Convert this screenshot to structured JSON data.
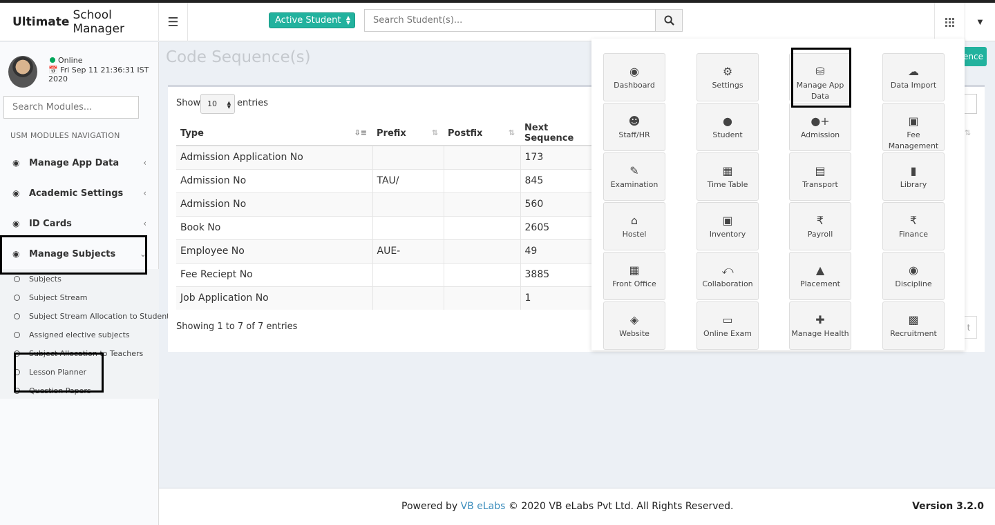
{
  "header": {
    "brand_bold": "Ultimate",
    "brand_rest": "School Manager",
    "student_filter": "Active Student",
    "search_placeholder": "Search Student(s)..."
  },
  "sidebar": {
    "status": "Online",
    "datetime": "Fri Sep 11 21:36:31 IST 2020",
    "module_search_placeholder": "Search Modules...",
    "nav_header": "USM MODULES NAVIGATION",
    "items": [
      {
        "label": "Manage App Data"
      },
      {
        "label": "Academic Settings"
      },
      {
        "label": "ID Cards"
      },
      {
        "label": "Manage Subjects"
      }
    ],
    "sub_items": [
      {
        "label": "Subjects"
      },
      {
        "label": "Subject Stream"
      },
      {
        "label": "Subject Stream Allocation to Students"
      },
      {
        "label": "Assigned elective subjects"
      },
      {
        "label": "Subject Allocation to Teachers"
      },
      {
        "label": "Lesson Planner"
      },
      {
        "label": "Question Papers"
      }
    ]
  },
  "main": {
    "title": "Code Sequence(s)",
    "add_button_partial": "ence",
    "show": "Show",
    "entries_value": "10",
    "entries": "entries",
    "columns": [
      "Type",
      "Prefix",
      "Postfix",
      "Next Sequence"
    ],
    "rows": [
      {
        "type": "Admission Application No",
        "prefix": "",
        "postfix": "",
        "next": "173"
      },
      {
        "type": "Admission No",
        "prefix": "TAU/",
        "postfix": "",
        "next": "845"
      },
      {
        "type": "Admission No",
        "prefix": "",
        "postfix": "",
        "next": "560"
      },
      {
        "type": "Book No",
        "prefix": "",
        "postfix": "",
        "next": "2605"
      },
      {
        "type": "Employee No",
        "prefix": "AUE-",
        "postfix": "",
        "next": "49"
      },
      {
        "type": "Fee Reciept No",
        "prefix": "",
        "postfix": "",
        "next": "3885"
      },
      {
        "type": "Job Application No",
        "prefix": "",
        "postfix": "",
        "next": "1"
      }
    ],
    "showing": "Showing 1 to 7 of 7 entries",
    "next_partial": "t"
  },
  "apps": [
    {
      "label": "Dashboard",
      "icon": "dashboard-icon"
    },
    {
      "label": "Settings",
      "icon": "gears-icon"
    },
    {
      "label": "Manage App Data",
      "icon": "database-icon"
    },
    {
      "label": "Data Import",
      "icon": "cloud-upload-icon"
    },
    {
      "label": "Staff/HR",
      "icon": "users-icon"
    },
    {
      "label": "Student",
      "icon": "user-icon"
    },
    {
      "label": "Admission",
      "icon": "user-plus-icon"
    },
    {
      "label": "Fee Management",
      "icon": "money-icon"
    },
    {
      "label": "Examination",
      "icon": "edit-icon"
    },
    {
      "label": "Time Table",
      "icon": "calendar-icon"
    },
    {
      "label": "Transport",
      "icon": "bus-icon"
    },
    {
      "label": "Library",
      "icon": "book-icon"
    },
    {
      "label": "Hostel",
      "icon": "home-icon"
    },
    {
      "label": "Inventory",
      "icon": "money-icon"
    },
    {
      "label": "Payroll",
      "icon": "rupee-icon"
    },
    {
      "label": "Finance",
      "icon": "rupee-icon"
    },
    {
      "label": "Front Office",
      "icon": "calendar-icon"
    },
    {
      "label": "Collaboration",
      "icon": "share-icon"
    },
    {
      "label": "Placement",
      "icon": "graduation-cap-icon"
    },
    {
      "label": "Discipline",
      "icon": "eye-icon"
    },
    {
      "label": "Website",
      "icon": "globe-icon"
    },
    {
      "label": "Online Exam",
      "icon": "laptop-icon"
    },
    {
      "label": "Manage Health",
      "icon": "medkit-icon"
    },
    {
      "label": "Recruitment",
      "icon": "briefcase-icon"
    }
  ],
  "footer": {
    "powered": "Powered by",
    "company_link": "VB eLabs",
    "copyright": "© 2020 VB eLabs Pvt Ltd. All Rights Reserved.",
    "version": "Version 3.2.0"
  },
  "colors": {
    "accent": "#22b29e",
    "link": "#3c8dbc",
    "online": "#00a65a"
  }
}
